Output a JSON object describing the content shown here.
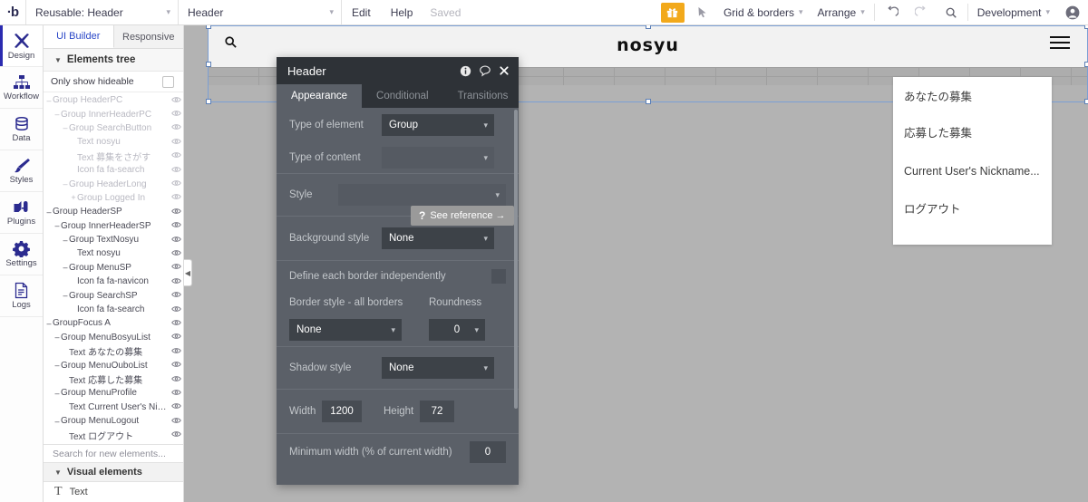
{
  "topbar": {
    "logo": "·b",
    "app_select": "Reusable: Header",
    "element_select": "Header",
    "edit_label": "Edit",
    "help_label": "Help",
    "saved_label": "Saved",
    "gift_icon": "gift-icon",
    "pointer_icon": "pointer-icon",
    "grid_borders_label": "Grid & borders",
    "arrange_label": "Arrange",
    "undo_icon": "undo-icon",
    "redo_icon": "redo-icon",
    "search_icon": "search-icon",
    "version_label": "Development",
    "account_icon": "account-icon",
    "caret": "▾"
  },
  "rail": {
    "items": [
      {
        "label": "Design",
        "icon": "design-icon",
        "active": true
      },
      {
        "label": "Workflow",
        "icon": "workflow-icon",
        "active": false
      },
      {
        "label": "Data",
        "icon": "data-icon",
        "active": false
      },
      {
        "label": "Styles",
        "icon": "styles-icon",
        "active": false
      },
      {
        "label": "Plugins",
        "icon": "plugins-icon",
        "active": false
      },
      {
        "label": "Settings",
        "icon": "settings-icon",
        "active": false
      },
      {
        "label": "Logs",
        "icon": "logs-icon",
        "active": false
      }
    ]
  },
  "tree_panel": {
    "tabs": [
      {
        "label": "UI Builder",
        "active": true
      },
      {
        "label": "Responsive",
        "active": false
      }
    ],
    "section_title": "Elements tree",
    "hideable_label": "Only show hideable",
    "hideable_checked": false,
    "search_placeholder": "Search for new elements...",
    "visual_elements_label": "Visual elements",
    "visual_items": [
      {
        "label": "Text",
        "icon": "text-icon"
      }
    ],
    "items": [
      {
        "label": "Group HeaderPC",
        "indent": 0,
        "toggle": "–",
        "dim": true,
        "eye": "off"
      },
      {
        "label": "Group InnerHeaderPC",
        "indent": 1,
        "toggle": "–",
        "dim": true,
        "eye": "off"
      },
      {
        "label": "Group SearchButton",
        "indent": 2,
        "toggle": "–",
        "dim": true,
        "eye": "off"
      },
      {
        "label": "Text nosyu",
        "indent": 3,
        "toggle": "",
        "dim": true,
        "eye": "off"
      },
      {
        "label": "Text 募集をさがす",
        "indent": 3,
        "toggle": "",
        "dim": true,
        "eye": "off"
      },
      {
        "label": "Icon fa fa-search",
        "indent": 3,
        "toggle": "",
        "dim": true,
        "eye": "off"
      },
      {
        "label": "Group HeaderLong",
        "indent": 2,
        "toggle": "–",
        "dim": true,
        "eye": "off"
      },
      {
        "label": "Group Logged In",
        "indent": 3,
        "toggle": "+",
        "dim": true,
        "eye": "off"
      },
      {
        "label": "Group HeaderSP",
        "indent": 0,
        "toggle": "–",
        "dim": false,
        "eye": "on"
      },
      {
        "label": "Group InnerHeaderSP",
        "indent": 1,
        "toggle": "–",
        "dim": false,
        "eye": "on"
      },
      {
        "label": "Group TextNosyu",
        "indent": 2,
        "toggle": "–",
        "dim": false,
        "eye": "on"
      },
      {
        "label": "Text nosyu",
        "indent": 3,
        "toggle": "",
        "dim": false,
        "eye": "on"
      },
      {
        "label": "Group MenuSP",
        "indent": 2,
        "toggle": "–",
        "dim": false,
        "eye": "on"
      },
      {
        "label": "Icon fa fa-navicon",
        "indent": 3,
        "toggle": "",
        "dim": false,
        "eye": "on"
      },
      {
        "label": "Group SearchSP",
        "indent": 2,
        "toggle": "–",
        "dim": false,
        "eye": "on"
      },
      {
        "label": "Icon fa fa-search",
        "indent": 3,
        "toggle": "",
        "dim": false,
        "eye": "on"
      },
      {
        "label": "GroupFocus A",
        "indent": 0,
        "toggle": "–",
        "dim": false,
        "eye": "on"
      },
      {
        "label": "Group MenuBosyuList",
        "indent": 1,
        "toggle": "–",
        "dim": false,
        "eye": "on"
      },
      {
        "label": "Text あなたの募集",
        "indent": 2,
        "toggle": "",
        "dim": false,
        "eye": "on"
      },
      {
        "label": "Group MenuOuboList",
        "indent": 1,
        "toggle": "–",
        "dim": false,
        "eye": "on"
      },
      {
        "label": "Text 応募した募集",
        "indent": 2,
        "toggle": "",
        "dim": false,
        "eye": "on"
      },
      {
        "label": "Group MenuProfile",
        "indent": 1,
        "toggle": "–",
        "dim": false,
        "eye": "on"
      },
      {
        "label": "Text Current User's Nickn",
        "indent": 2,
        "toggle": "",
        "dim": false,
        "eye": "on"
      },
      {
        "label": "Group MenuLogout",
        "indent": 1,
        "toggle": "–",
        "dim": false,
        "eye": "on"
      },
      {
        "label": "Text ログアウト",
        "indent": 2,
        "toggle": "",
        "dim": false,
        "eye": "on"
      }
    ]
  },
  "canvas": {
    "collapse_icon": "collapse-panel-icon",
    "page_header": {
      "search_icon": "search-icon",
      "logo_text": "nosyu",
      "menu_icon": "hamburger-icon"
    },
    "dropdown_menu": {
      "items": [
        "あなたの募集",
        "応募した募集",
        "Current User's Nickname...",
        "ログアウト"
      ]
    }
  },
  "dialog": {
    "title": "Header",
    "info_icon": "info-icon",
    "comment_icon": "comment-icon",
    "close_icon": "close-icon",
    "tabs": [
      {
        "label": "Appearance",
        "active": true
      },
      {
        "label": "Conditional",
        "active": false
      },
      {
        "label": "Transitions",
        "active": false
      }
    ],
    "fields": {
      "type_of_element_label": "Type of element",
      "type_of_element_value": "Group",
      "type_of_content_label": "Type of content",
      "type_of_content_value": "",
      "style_label": "Style",
      "style_value": "",
      "background_style_label": "Background style",
      "background_style_value": "None",
      "see_reference_label": "See reference →",
      "see_reference_mark": "?",
      "define_borders_label": "Define each border independently",
      "define_borders_checked": false,
      "border_style_label": "Border style - all borders",
      "border_style_value": "None",
      "roundness_label": "Roundness",
      "roundness_value": "0",
      "shadow_style_label": "Shadow style",
      "shadow_style_value": "None",
      "width_label": "Width",
      "width_value": "1200",
      "height_label": "Height",
      "height_value": "72",
      "min_width_label": "Minimum width (% of current width)",
      "min_width_value": "0"
    },
    "caret": "▾"
  },
  "colors": {
    "accent_blue": "#2b2bb0",
    "gift_orange": "#f2a91b",
    "dialog_bg": "#5b6068",
    "dialog_header": "#2e3237",
    "canvas_bg": "#b3b3b3",
    "selection": "#7b9fd4"
  }
}
